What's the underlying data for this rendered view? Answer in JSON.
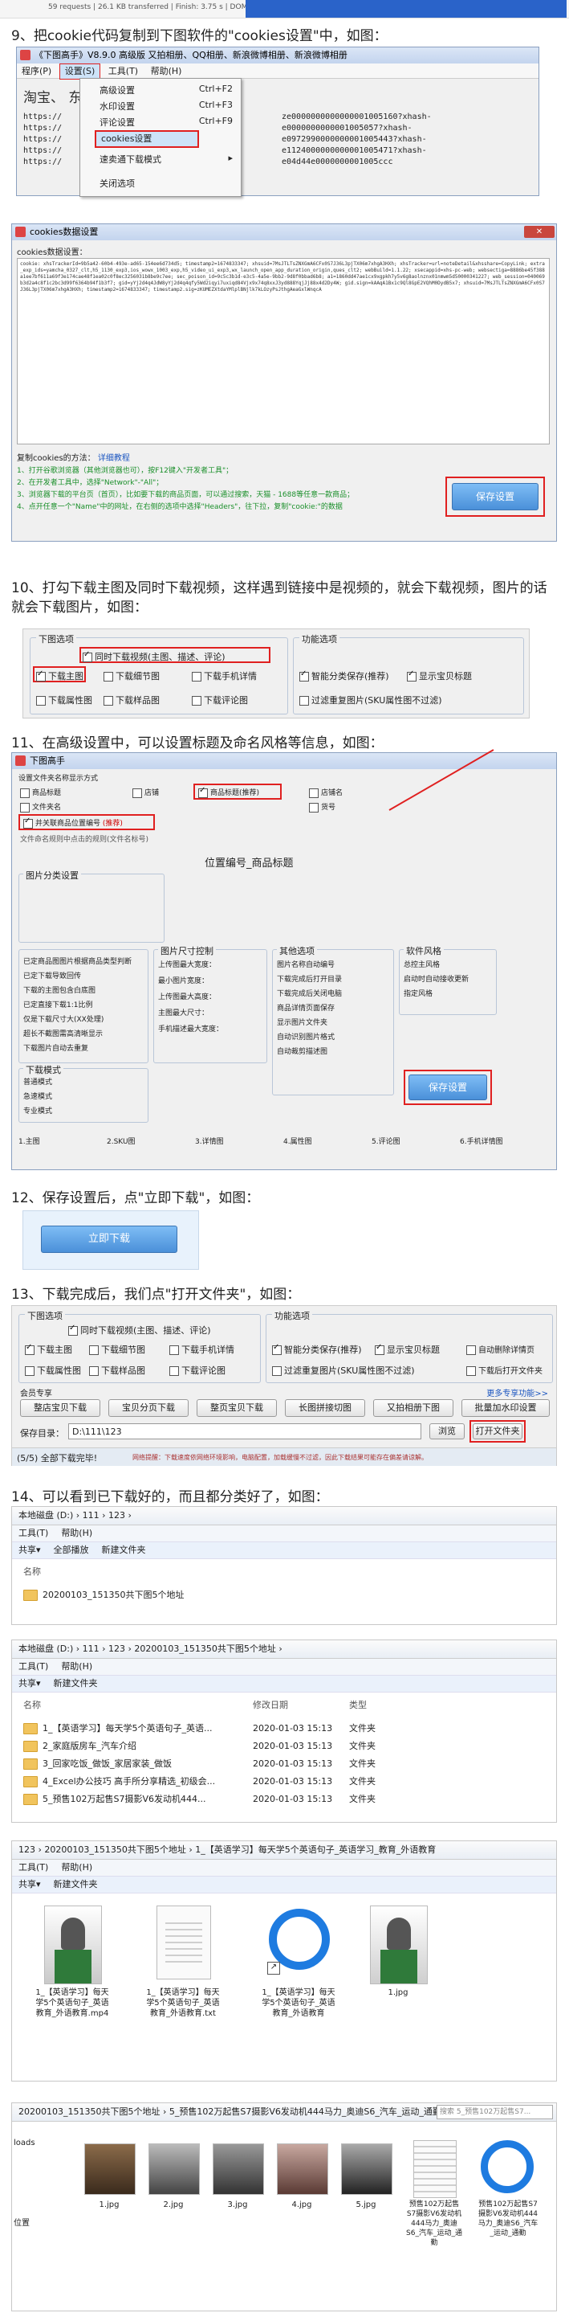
{
  "top_strip": {
    "text": "59 requests | 26.1 KB transferred | Finish: 3.75 s | DOM..."
  },
  "step9": {
    "heading": "9、把cookie代码复制到下图软件的\"cookies设置\"中，如图：",
    "window_title": "《下图高手》V8.9.0  高级版  又拍相册、QQ相册、新浪微博相册、新浪微博相册",
    "menu": [
      "程序(P)",
      "设置(S)",
      "工具(T)",
      "帮助(H)"
    ],
    "dropdown": [
      {
        "label": "高级设置",
        "shortcut": "Ctrl+F2"
      },
      {
        "label": "水印设置",
        "shortcut": "Ctrl+F3"
      },
      {
        "label": "评论设置",
        "shortcut": "Ctrl+F9"
      },
      {
        "label": "cookies设置",
        "shortcut": ""
      },
      {
        "label": "速卖通下载模式",
        "shortcut": "▸"
      },
      {
        "label": "关闭选项",
        "shortcut": ""
      }
    ],
    "bg_text": "淘宝、  东、速卖通、易贝、",
    "url_lines": [
      "https://",
      "https://",
      "https://",
      "https://",
      "https://"
    ],
    "url_tails": [
      "ze0000000000000001005160?xhash-",
      "e0000000000001005057?xhash-",
      "e0972990000000001005443?xhash-",
      "e1124000000000001005471?xhash-",
      "e04d44e0000000001005ccc"
    ],
    "cookies_window_title": "cookies数据设置",
    "cookies_label": "cookies数据设置：",
    "cookies_text": "cookie: xhsTrackerId=9b5a42-60b4-493e-ad65-154ee6d734d5; timestamp2=1674833347; xhsuid=7MsJTLTsZNXGmA6CFx0S7J36L3pjTX06m7xhgA3HXh; xhsTracker=url=noteDetail&xhsshare=CopyLink; extra_exp_ids=yamcha_0327_clt,h5_1130_exp3,ios_wowx_1003_exp,h5_video_ui_exp3,wx_launch_open_app_duration_origin,ques_clt2; webBuild=1.1.22; xsecappid=xhs-pc-web; websectiga=8886be45f388a1ee7bf611a69f3e174cae48f1ea02c0f8ec3256031b8be9c7ee; sec_poison_id=9c5c3b1d-e3c5-4a5e-9bb2-9d8f0bbad6b8; a1=1860dd47ae1cx9xgpkh7y5v6g8aolnznx01nmwm5d50000341227; web_session=040069b3d2a4c8f1c2bc3d99f6364b94f1b3f7; gid=yYj2d4q4JdW8yYj2d4q4qfy5Wd2iqyi7uxiqd84Vjx9x74q8xxJ3yd888YqjJj88x4d2Dy4W; gid.sign=kAAqA1Bx1c9Ql8GpE2VQhM0DydB5x7; xhsuid=7MsJTLTsZNXGmA6CFx0S7J36L3pjTX06m7xhgA3HXh; timestamp2=1674833347; timestamp2.sig=zKUMEZXtdaYMlplBNjlk7kLOzyPsJthgAeaGxlWnqcA",
    "cookies_help": [
      "1、打开谷歌浏览器（其他浏览器也可），按F12键入\"开发者工具\"；",
      "2、在开发者工具中，选择\"Network\"-\"All\"；",
      "3、浏览器下载的平台页（首页），比如要下载的商品页面，可以通过搜索，天猫 - 1688等任意一款商品；",
      "4、点开任意一个\"Name\"中的网址，在右侧的选项中选择\"Headers\"，往下拉，复制\"cookie:\"的数据"
    ],
    "cookies_help_title": "复制cookies的方法：",
    "cookies_help_link": "详细教程",
    "save_button": "保存设置"
  },
  "step10": {
    "heading": "10、打勾下载主图及同时下载视频，这样遇到链接中是视频的，就会下载视频，图片的话就会下载图片，如图：",
    "group1_title": "下图选项",
    "group2_title": "功能选项",
    "options": [
      {
        "label": "同时下载视频(主图、描述、评论)",
        "checked": true
      },
      {
        "label": "下载主图",
        "checked": true
      },
      {
        "label": "下载细节图",
        "checked": false
      },
      {
        "label": "下载手机详情",
        "checked": false
      },
      {
        "label": "下载属性图",
        "checked": false
      },
      {
        "label": "下载样品图",
        "checked": false
      },
      {
        "label": "下载评论图",
        "checked": false
      }
    ],
    "func_options": [
      {
        "label": "智能分类保存(推荐)",
        "checked": true
      },
      {
        "label": "显示宝贝标题",
        "checked": true
      },
      {
        "label": "过滤重复图片(SKU属性图不过滤)",
        "checked": false
      }
    ]
  },
  "step11": {
    "heading": "11、在高级设置中，可以设置标题及命名风格等信息，如图：",
    "window_title": "下图高手",
    "sub_title": "设置文件夹名称显示方式",
    "name_label": "位置编号_商品标题",
    "seg1": "文件命名规则中点击的规则(文件名标号)",
    "fields": [
      "商品标题",
      "商品标题(推荐)",
      "文件夹名",
      "店铺",
      "商品标题",
      "店铺名",
      "货号"
    ],
    "highlight": "并关联商品位置编号",
    "highlight_note": "(推荐)",
    "groups": [
      "图片分类设置",
      "图片尺寸控制",
      "其他选项",
      "软件风格",
      "下载模式"
    ],
    "left_opts": [
      "已定商品图图片根据商品类型判断",
      "已定下载导致回传",
      "下载的主图包含白底图",
      "已定直接下载1:1比例",
      "仅是下载尺寸大(XX处理)",
      "超长不截图需高清晰显示",
      "下载图片自动去重复"
    ],
    "mid_opts": [
      "上传图最大宽度：",
      "最小图片宽度：",
      "上传图最大高度：",
      "主图最大尺寸：",
      "手机描述最大宽度："
    ],
    "right_opts": [
      "图片名称自动编号",
      "下载完成后打开目录",
      "下载完成后关闭电脑",
      "商品详情页面保存",
      "显示图片文件夹",
      "自动识别图片格式",
      "自动裁剪描述图"
    ],
    "style_opts": [
      "总控主风格",
      "启动时自动接收更新",
      "指定风格"
    ],
    "mode_opts": [
      "普通模式",
      "急速模式",
      "专业模式"
    ],
    "bottom_cols": [
      "1.主图",
      "2.SKU图",
      "3.详情图",
      "4.属性图",
      "5.评论图",
      "6.手机详情图"
    ],
    "save_button": "保存设置"
  },
  "step12": {
    "heading": "12、保存设置后，点\"立即下载\"，如图：",
    "button": "立即下载"
  },
  "step13": {
    "heading": "13、下载完成后，我们点\"打开文件夹\"，如图：",
    "group1_title": "下图选项",
    "group2_title": "功能选项",
    "options": [
      {
        "label": "同时下载视频(主图、描述、评论)",
        "checked": true
      },
      {
        "label": "下载主图",
        "checked": true
      },
      {
        "label": "下载细节图",
        "checked": false
      },
      {
        "label": "下载手机详情",
        "checked": false
      },
      {
        "label": "下载属性图",
        "checked": false
      },
      {
        "label": "下载样品图",
        "checked": false
      },
      {
        "label": "下载评论图",
        "checked": false
      }
    ],
    "func_options": [
      {
        "label": "智能分类保存(推荐)",
        "checked": true
      },
      {
        "label": "显示宝贝标题",
        "checked": true
      },
      {
        "label": "自动删除详情页",
        "checked": false
      },
      {
        "label": "过滤重复图片(SKU属性图不过滤)",
        "checked": false
      },
      {
        "label": "下载后打开文件夹",
        "checked": false
      }
    ],
    "member_label": "会员专享",
    "more_link": "更多专享功能>>",
    "tool_buttons": [
      "整店宝贝下载",
      "宝贝分页下载",
      "整页宝贝下载",
      "长图拼接切图",
      "又拍相册下图",
      "批量加水印设置"
    ],
    "save_label": "保存目录：",
    "save_path": "D:\\111\\123",
    "browse": "浏览",
    "open_folder": "打开文件夹",
    "status": "(5/5) 全部下载完毕!",
    "status_tip": "网络提醒：下载速度依网络环境影响，电脑配置，加载缓慢不过滤，因此下载结果可能存在偏差请谅解。"
  },
  "step14": {
    "heading": "14、可以看到已下载好的，而且都分类好了，如图：",
    "ex1": {
      "path": "本地磁盘 (D:) › 111 › 123 ›",
      "menu": [
        "工具(T)",
        "帮助(H)"
      ],
      "toolbar": [
        "共享▾",
        "全部播放",
        "新建文件夹"
      ],
      "col": "名称",
      "folder": "20200103_151350共下图5个地址"
    },
    "ex2": {
      "path": "本地磁盘 (D:) › 111 › 123 › 20200103_151350共下图5个地址 ›",
      "menu": [
        "工具(T)",
        "帮助(H)"
      ],
      "toolbar": [
        "共享▾",
        "新建文件夹"
      ],
      "cols": [
        "名称",
        "修改日期",
        "类型"
      ],
      "rows": [
        {
          "name": "1_【英语学习】每天学5个英语句子_英语...",
          "date": "2020-01-03 15:13",
          "type": "文件夹"
        },
        {
          "name": "2_家庭版房车_汽车介绍",
          "date": "2020-01-03 15:13",
          "type": "文件夹"
        },
        {
          "name": "3_回家吃饭_做饭_家居家装_做饭",
          "date": "2020-01-03 15:13",
          "type": "文件夹"
        },
        {
          "name": "4_Excel办公技巧 高手所分享精选_初级会...",
          "date": "2020-01-03 15:13",
          "type": "文件夹"
        },
        {
          "name": "5_预售102万起售S7摄影V6发动机444...",
          "date": "2020-01-03 15:13",
          "type": "文件夹"
        }
      ]
    },
    "ex3": {
      "path": "123 › 20200103_151350共下图5个地址 › 1_【英语学习】每天学5个英语句子_英语学习_教育_外语教育",
      "menu": [
        "工具(T)",
        "帮助(H)"
      ],
      "toolbar": [
        "共享▾",
        "新建文件夹"
      ],
      "files": [
        {
          "name": "1_【英语学习】每天学5个英语句子_英语教育_外语教育.mp4"
        },
        {
          "name": "1_【英语学习】每天学5个英语句子_英语教育_外语教育.txt"
        },
        {
          "name": "1_【英语学习】每天学5个英语句子_英语教育_外语教育"
        },
        {
          "name": "1.jpg"
        }
      ]
    },
    "ex4": {
      "path": "20200103_151350共下图5个地址 › 5_预售102万起售S7摄影V6发动机444马力_奥迪S6_汽车_运动_通勤_奥迪",
      "search": "搜索 5_预售102万起售S7...",
      "side": [
        "loads",
        "位置"
      ],
      "files": [
        "1.jpg",
        "2.jpg",
        "3.jpg",
        "4.jpg",
        "5.jpg",
        "预售102万起售S7摄影V6发动机444马力_奥迪S6_汽车_运动_通勤",
        "预售102万起售S7摄影V6发动机444马力_奥迪S6_汽车_运动_通勤"
      ]
    }
  }
}
